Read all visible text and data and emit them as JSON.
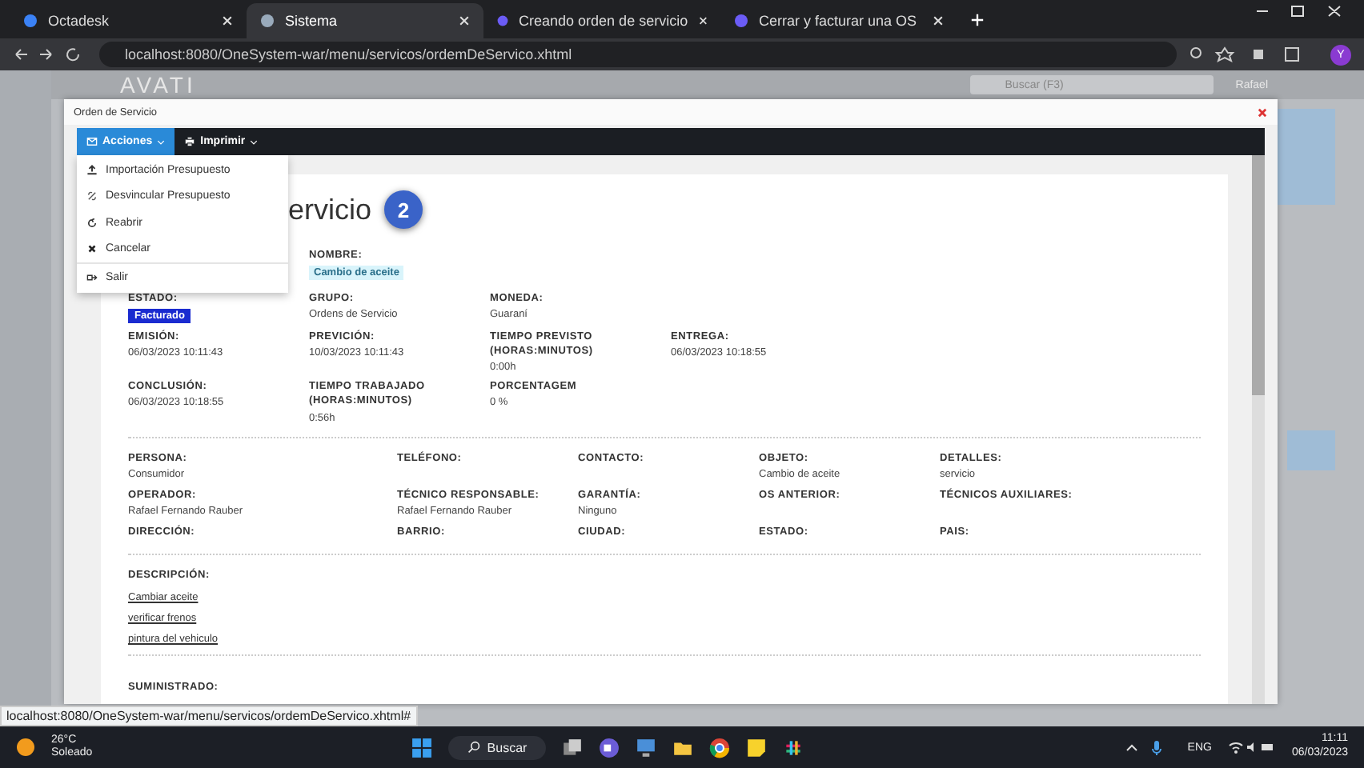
{
  "browser": {
    "tabs": [
      {
        "label": "Octadesk",
        "selected": false
      },
      {
        "label": "Sistema",
        "selected": true
      },
      {
        "label": "Creando orden de servicio",
        "selected": false
      },
      {
        "label": "Cerrar y facturar una OS",
        "selected": false
      }
    ],
    "url": "localhost:8080/OneSystem-war/menu/servicos/ordemDeServico.xhtml",
    "profile": "Y"
  },
  "app": {
    "logo": "AVATI",
    "search": {
      "placeholder": "Buscar (F3)"
    },
    "user": "Rafael"
  },
  "dialog": {
    "title": "Orden de Servicio",
    "toolbar": [
      {
        "label": "Acciones",
        "selected": true
      },
      {
        "label": "Imprimir",
        "selected": false
      }
    ],
    "menu": [
      "Importación Presupuesto",
      "Desvincular Presupuesto",
      "Reabrir",
      "Cancelar",
      "Salir"
    ],
    "heading": "ervicio",
    "badge": "2",
    "top_rows": [
      [
        {
          "label": "NOMBRE:",
          "value": "Cambio de aceite",
          "kind": "tag"
        }
      ],
      [
        {
          "label": "ESTADO:",
          "value": "Facturado",
          "kind": "badge"
        },
        {
          "label": "GRUPO:",
          "value": "Ordens de Servicio",
          "kind": "text"
        },
        {
          "label": "MONEDA:",
          "value": "Guaraní",
          "kind": "text"
        }
      ],
      [
        {
          "label": "EMISIÓN:",
          "value": "06/03/2023 10:11:43",
          "kind": "text"
        },
        {
          "label": "PREVICIÓN:",
          "value": "10/03/2023 10:11:43",
          "kind": "text"
        },
        {
          "label": "TIEMPO PREVISTO (HORAS:MINUTOS)",
          "value": "0:00h",
          "kind": "text"
        },
        {
          "label": "ENTREGA:",
          "value": "06/03/2023 10:18:55",
          "kind": "text"
        }
      ],
      [
        {
          "label": "CONCLUSIÓN:",
          "value": "06/03/2023 10:18:55",
          "kind": "text"
        },
        {
          "label": "TIEMPO TRABAJADO (HORAS:MINUTOS)",
          "value": "0:56h",
          "kind": "text"
        },
        {
          "label": "PORCENTAGEM",
          "value": "0 %",
          "kind": "text"
        }
      ]
    ],
    "person_rows": [
      [
        {
          "label": "PERSONA:",
          "value": "Consumidor"
        },
        {
          "label": "TELÉFONO:"
        },
        {
          "label": "CONTACTO:"
        },
        {
          "label": "OBJETO:",
          "value": "Cambio de aceite"
        },
        {
          "label": "DETALLES:",
          "value": "servicio"
        }
      ],
      [
        {
          "label": "OPERADOR:",
          "value": "Rafael Fernando Rauber"
        },
        {
          "label": "TÉCNICO RESPONSABLE:",
          "value": "Rafael Fernando Rauber"
        },
        {
          "label": "GARANTÍA:",
          "value": "Ninguno"
        },
        {
          "label": "OS ANTERIOR:"
        },
        {
          "label": "TÉCNICOS AUXILIARES:"
        }
      ],
      [
        {
          "label": "DIRECCIÓN:"
        },
        {
          "label": "BARRIO:"
        },
        {
          "label": "CIUDAD:"
        },
        {
          "label": "ESTADO:"
        },
        {
          "label": "PAIS:"
        }
      ]
    ],
    "description": {
      "label": "DESCRIPCIÓN:",
      "items": [
        "Cambiar aceite",
        "verificar frenos",
        "pintura del vehiculo"
      ]
    },
    "supplied": {
      "label": "SUMINISTRADO:"
    }
  },
  "status_url": "localhost:8080/OneSystem-war/menu/servicos/ordemDeServico.xhtml#",
  "taskbar": {
    "temperature": "26°C",
    "weather": "Soleado",
    "search": "Buscar",
    "language": "ENG",
    "time": "11:11",
    "date": "06/03/2023"
  }
}
